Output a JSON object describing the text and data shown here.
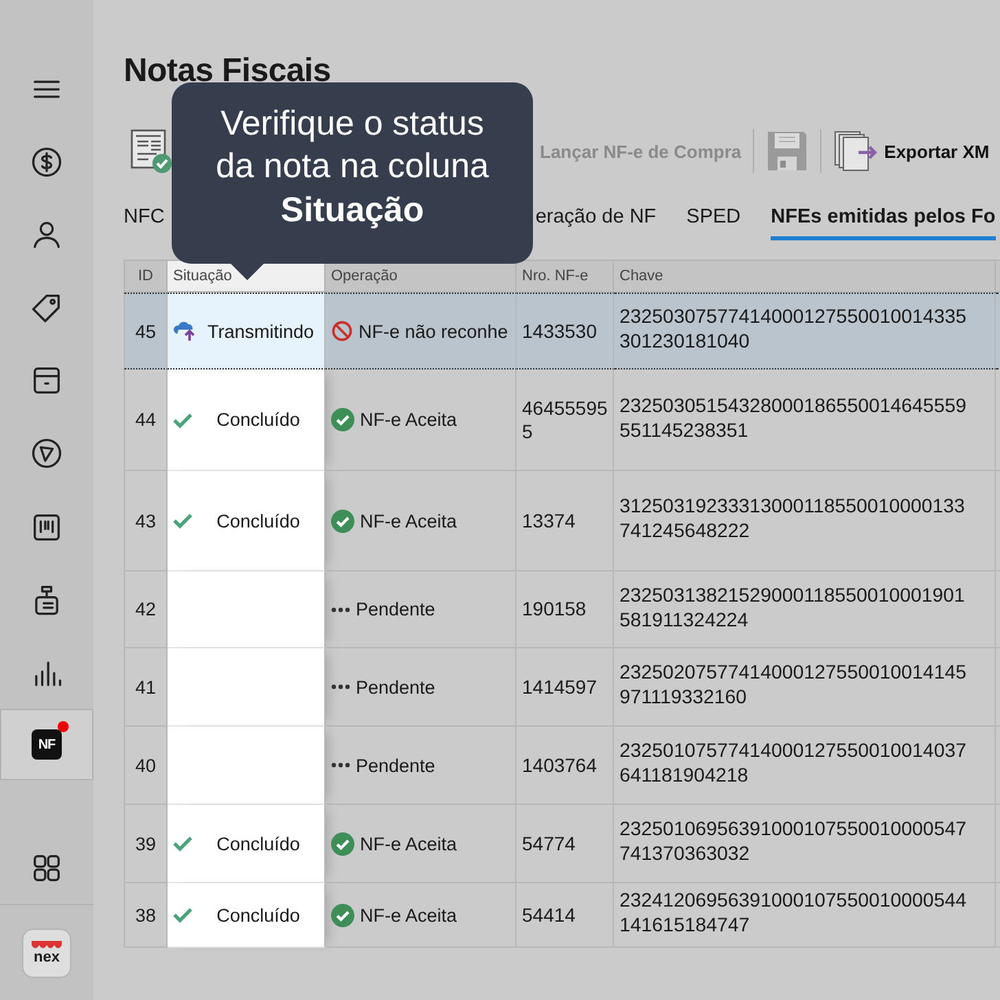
{
  "sidebar": {
    "items": [
      {
        "kind": "menu",
        "selected": false
      },
      {
        "kind": "money",
        "selected": false
      },
      {
        "kind": "user",
        "selected": false
      },
      {
        "kind": "tag",
        "selected": false
      },
      {
        "kind": "box",
        "selected": false
      },
      {
        "kind": "disc",
        "selected": false
      },
      {
        "kind": "barcode",
        "selected": false
      },
      {
        "kind": "register",
        "selected": false
      },
      {
        "kind": "chart",
        "selected": false
      },
      {
        "kind": "nf",
        "label": "NF",
        "selected": true,
        "notification": true
      },
      {
        "kind": "apps",
        "selected": false
      }
    ],
    "logo": {
      "text": "nex"
    }
  },
  "title": "Notas Fiscais",
  "toolbar": [
    {
      "kind": "issue"
    },
    {
      "kind": "purchase",
      "label": "Lançar NF-e de Compra",
      "disabled": true
    },
    {
      "kind": "save",
      "disabled": true
    },
    {
      "kind": "export",
      "label": "Exportar XM",
      "disabled": false
    }
  ],
  "tabs": [
    {
      "label": "NFC",
      "selected": false
    },
    {
      "label": "eração de NF",
      "selected": false
    },
    {
      "label": "SPED",
      "selected": false
    },
    {
      "label": "NFEs emitidas pelos Fo",
      "selected": true
    }
  ],
  "tooltip": {
    "text": "Verifique o status da nota na coluna **Situação**"
  },
  "table": {
    "columns": [
      {
        "label": "ID",
        "highlighted": false
      },
      {
        "label": "Situação",
        "highlighted": true
      },
      {
        "label": "Operação",
        "highlighted": false
      },
      {
        "label": "Nro. NF-e",
        "highlighted": false
      },
      {
        "label": "Chave",
        "highlighted": false
      }
    ],
    "rows": [
      {
        "id": "45",
        "selected": true,
        "status": {
          "kind": "transmitting",
          "text": "Transmitindo"
        },
        "operation": {
          "kind": "rejected",
          "text": "NF-e não reconhe"
        },
        "number": "1433530",
        "key": "23250307577414000127550010014335301230181040"
      },
      {
        "id": "44",
        "selected": false,
        "status": {
          "kind": "done",
          "text": "Concluído"
        },
        "operation": {
          "kind": "accepted",
          "text": "NF-e Aceita"
        },
        "number": "464555955",
        "key": "23250305154328000186550014645559551145238351"
      },
      {
        "id": "43",
        "selected": false,
        "status": {
          "kind": "done",
          "text": "Concluído"
        },
        "operation": {
          "kind": "accepted",
          "text": "NF-e Aceita"
        },
        "number": "13374",
        "key": "31250319233313000118550010000133741245648222"
      },
      {
        "id": "42",
        "selected": false,
        "operation": {
          "kind": "pending",
          "text": "Pendente"
        },
        "number": "190158",
        "key": "23250313821529000118550010001901581911324224"
      },
      {
        "id": "41",
        "selected": false,
        "operation": {
          "kind": "pending",
          "text": "Pendente"
        },
        "number": "1414597",
        "key": "23250207577414000127550010014145971119332160"
      },
      {
        "id": "40",
        "selected": false,
        "operation": {
          "kind": "pending",
          "text": "Pendente"
        },
        "number": "1403764",
        "key": "23250107577414000127550010014037641181904218"
      },
      {
        "id": "39",
        "selected": false,
        "status": {
          "kind": "done",
          "text": "Concluído"
        },
        "operation": {
          "kind": "accepted",
          "text": "NF-e Aceita"
        },
        "number": "54774",
        "key": "23250106956391000107550010000547741370363032"
      },
      {
        "id": "38",
        "selected": false,
        "status": {
          "kind": "done",
          "text": "Concluído"
        },
        "operation": {
          "kind": "accepted",
          "text": "NF-e Aceita"
        },
        "number": "54414",
        "key": "23241206956391000107550010000544141615184747"
      }
    ]
  }
}
